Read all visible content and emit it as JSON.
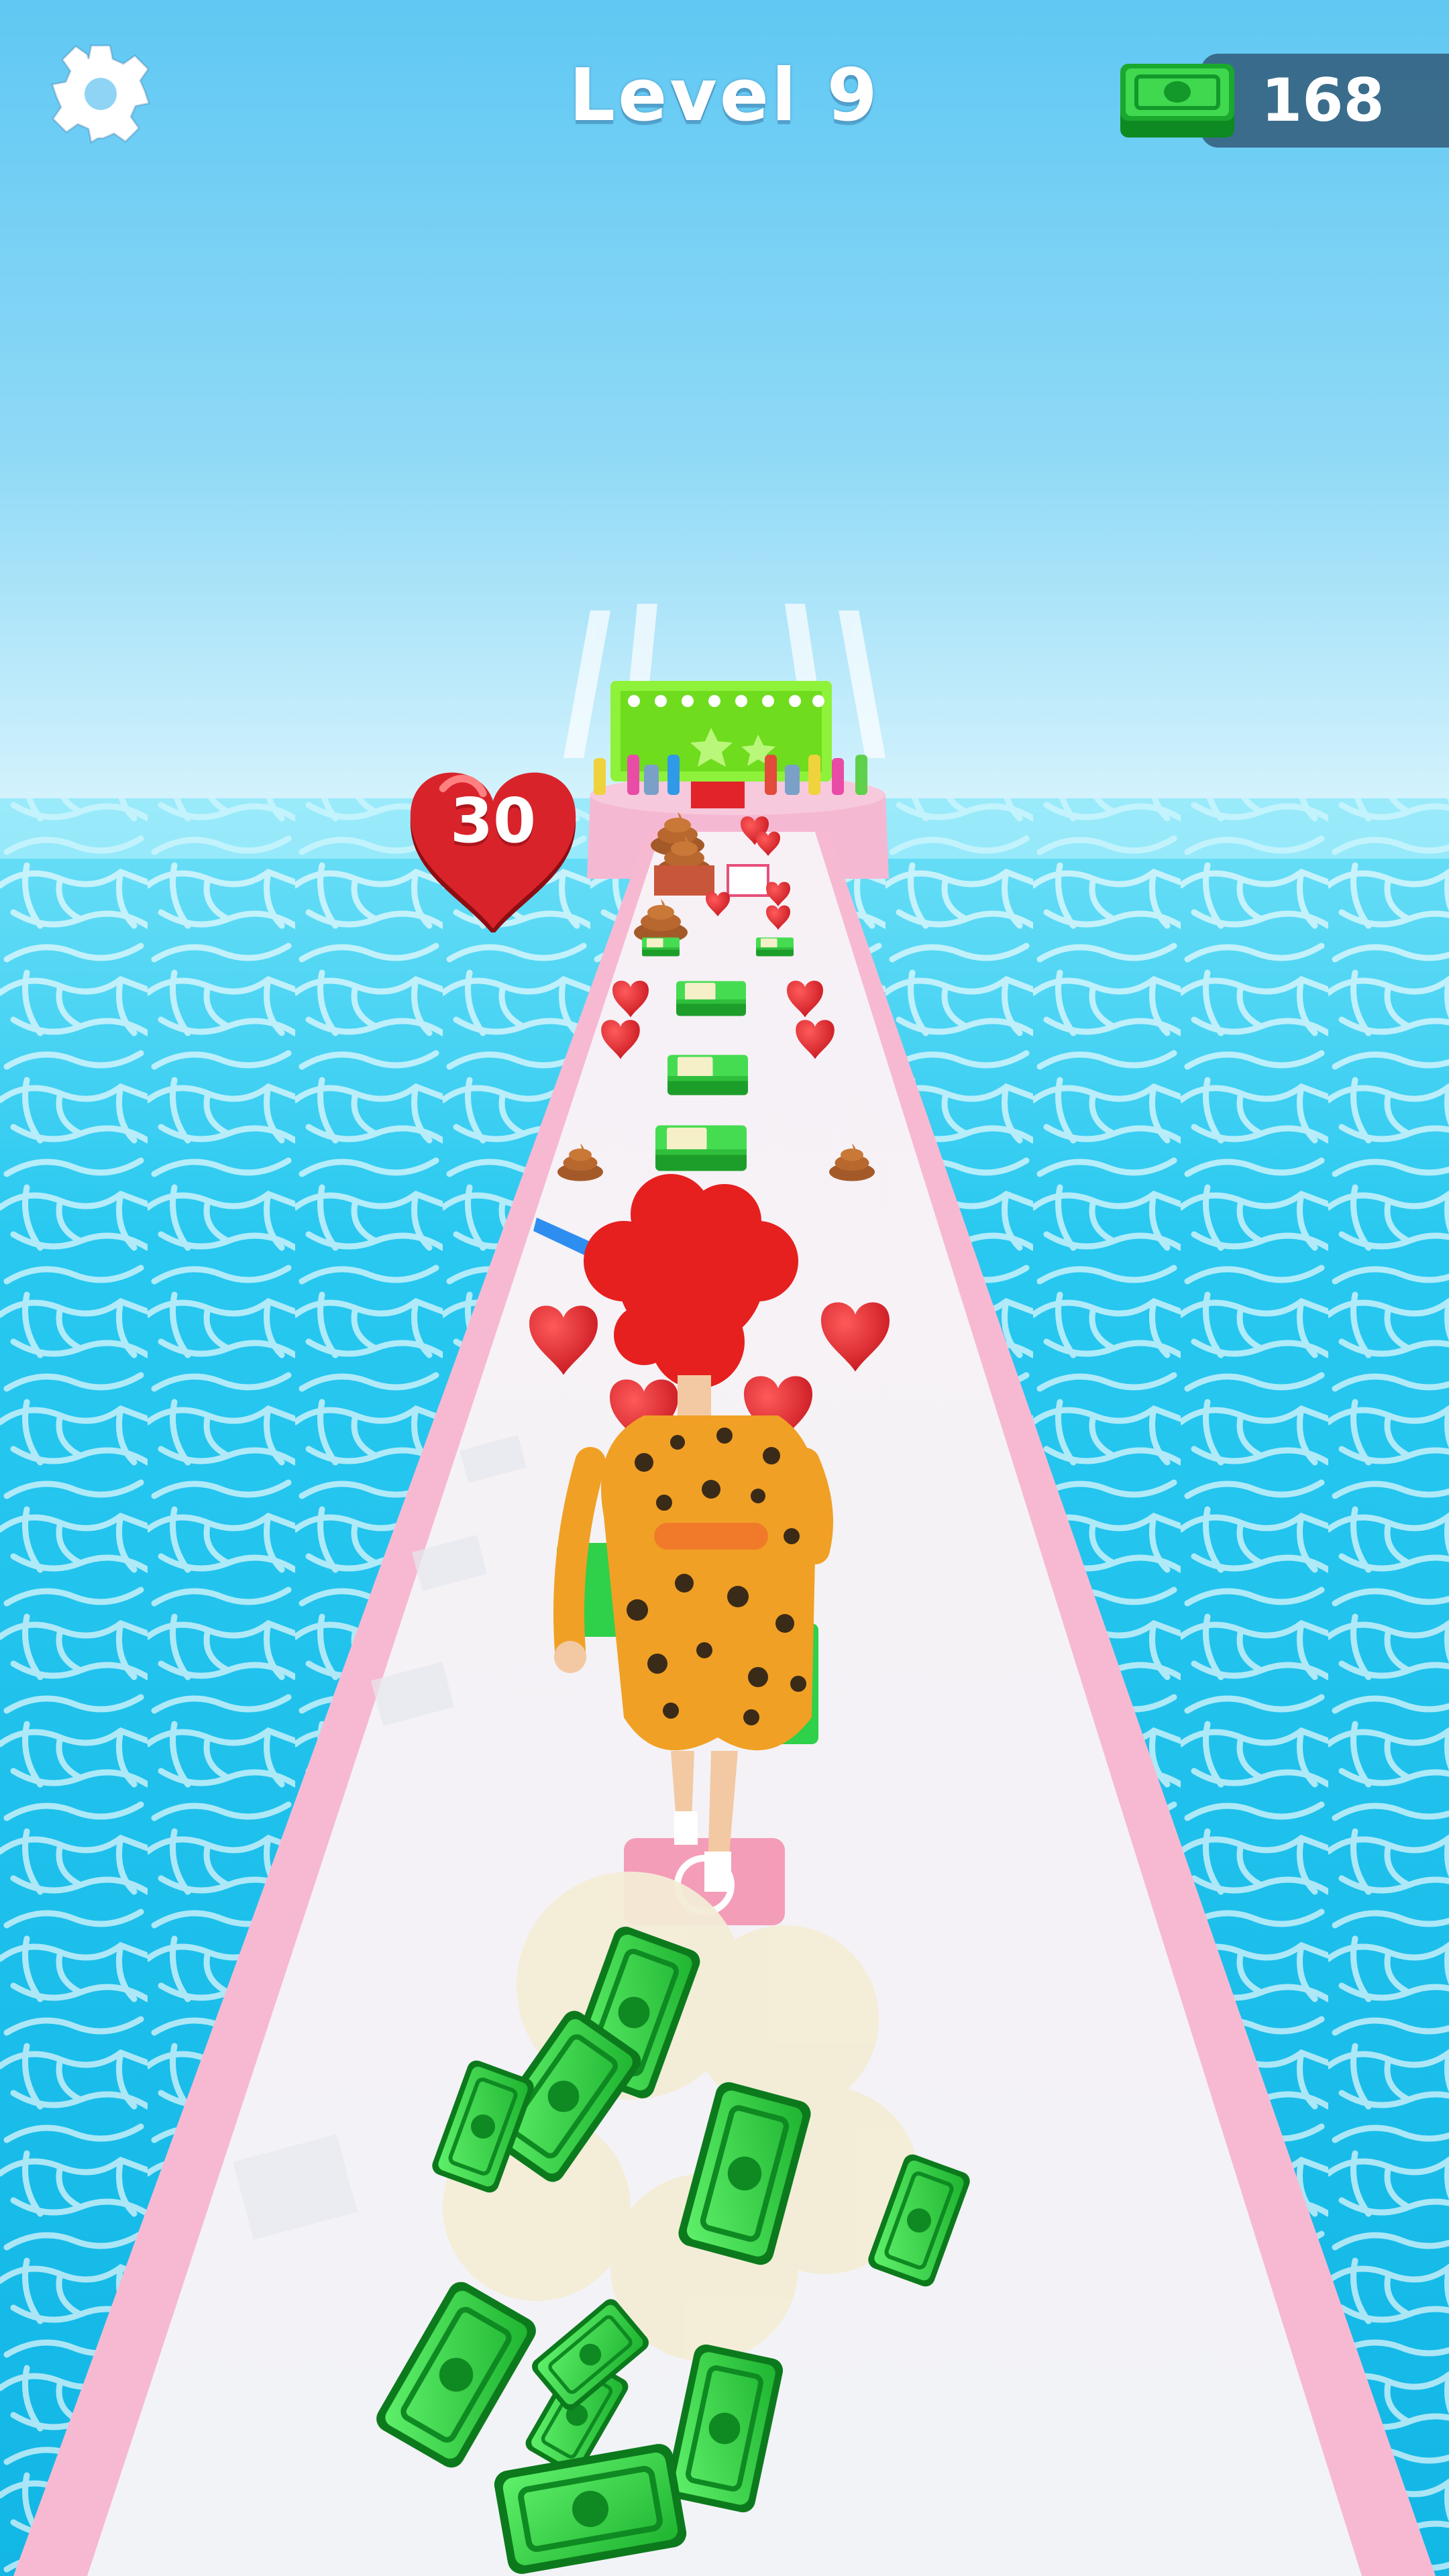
{
  "hud": {
    "level_label": "Level 9",
    "money": "168",
    "heart_count": "30"
  },
  "icons": {
    "settings": "gear-icon",
    "money": "cash-icon",
    "hearts": "heart-icon"
  },
  "colors": {
    "sky_top": "#5ec8f2",
    "sky_bottom": "#d4f3fd",
    "water": "#22c4ee",
    "runway": "#f3f4f8",
    "runway_border": "#f7b9d2",
    "heart": "#e0252c",
    "cash": "#2ecc40",
    "hair": "#e61f1f",
    "leopard": "#f0a024"
  }
}
